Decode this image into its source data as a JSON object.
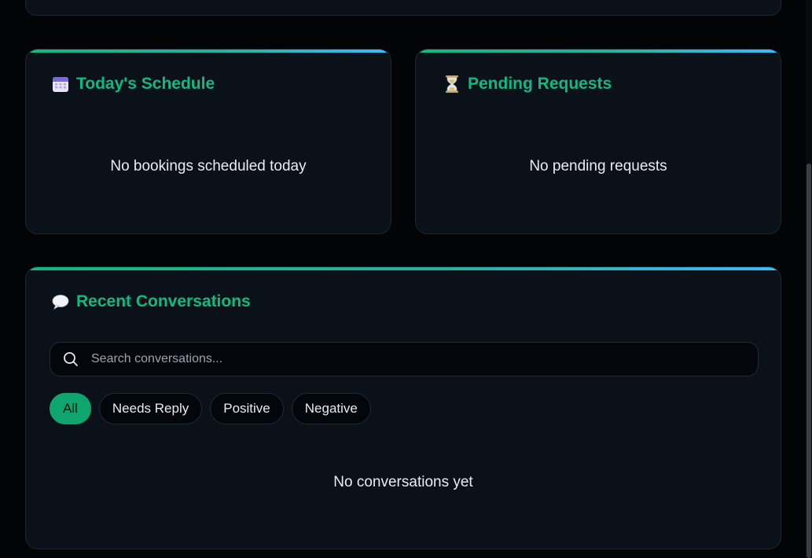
{
  "schedule": {
    "icon": "calendar-icon",
    "title": "Today's Schedule",
    "empty": "No bookings scheduled today"
  },
  "pending": {
    "icon": "hourglass-icon",
    "title": "Pending Requests",
    "empty": "No pending requests"
  },
  "conversations": {
    "icon": "speech-bubble-icon",
    "title": "Recent Conversations",
    "search_placeholder": "Search conversations...",
    "filters": [
      {
        "label": "All",
        "active": true
      },
      {
        "label": "Needs Reply",
        "active": false
      },
      {
        "label": "Positive",
        "active": false
      },
      {
        "label": "Negative",
        "active": false
      }
    ],
    "empty": "No conversations yet"
  },
  "colors": {
    "accent": "#10b981",
    "gradient_end": "#38bdf8",
    "card_bg": "#0a1119",
    "page_bg": "#030406"
  }
}
